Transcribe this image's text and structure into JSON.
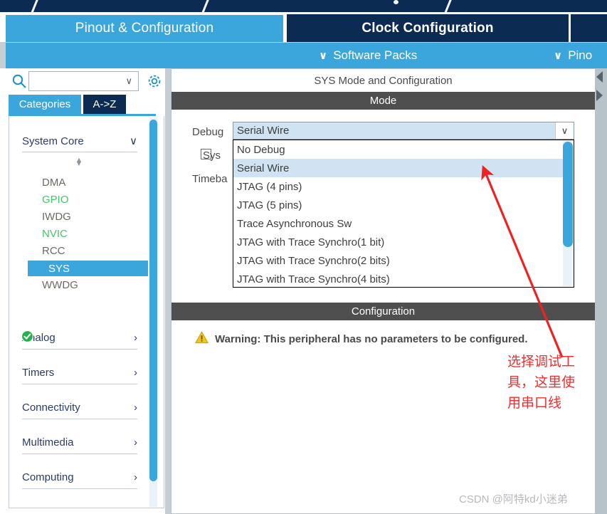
{
  "header": {
    "tabs": [
      {
        "label": "Pinout & Configuration",
        "state": "active"
      },
      {
        "label": "Clock Configuration",
        "state": "inactive"
      },
      {
        "label": "",
        "state": "inactive"
      }
    ],
    "sub_items": [
      {
        "label": "Software Packs",
        "chevron": "chevron-down-icon"
      },
      {
        "label": "Pino",
        "chevron": "chevron-down-icon"
      }
    ]
  },
  "sidebar": {
    "search": {
      "value": "",
      "placeholder": "",
      "icon": "search-icon",
      "caret": "chevron-down-icon"
    },
    "settings_icon": "gear-icon",
    "view_tabs": [
      {
        "label": "Categories",
        "selected": true
      },
      {
        "label": "A->Z",
        "selected": false
      }
    ],
    "groups": [
      {
        "label": "System Core",
        "expanded": true,
        "chevron": "chevron-down-icon"
      },
      {
        "label": "Analog",
        "expanded": false,
        "chevron": "chevron-right-icon"
      },
      {
        "label": "Timers",
        "expanded": false,
        "chevron": "chevron-right-icon"
      },
      {
        "label": "Connectivity",
        "expanded": false,
        "chevron": "chevron-right-icon"
      },
      {
        "label": "Multimedia",
        "expanded": false,
        "chevron": "chevron-right-icon"
      },
      {
        "label": "Computing",
        "expanded": false,
        "chevron": "chevron-right-icon"
      }
    ],
    "peripherals": [
      {
        "label": "DMA",
        "state": "normal"
      },
      {
        "label": "GPIO",
        "state": "configured"
      },
      {
        "label": "IWDG",
        "state": "normal"
      },
      {
        "label": "NVIC",
        "state": "configured"
      },
      {
        "label": "RCC",
        "state": "normal"
      },
      {
        "label": "SYS",
        "state": "selected",
        "icon": "check-circle-icon"
      },
      {
        "label": "WWDG",
        "state": "normal"
      }
    ]
  },
  "main": {
    "title": "SYS Mode and Configuration",
    "mode_header": "Mode",
    "config_header": "Configuration",
    "fields": {
      "debug_label": "Debug",
      "debug_value": "Serial Wire",
      "system_wake_label": "Sys",
      "system_wake_checked": false,
      "timebase_label": "Timeba"
    },
    "dropdown": {
      "open": true,
      "selected": "Serial Wire",
      "options": [
        "No Debug",
        "Serial Wire",
        "JTAG (4 pins)",
        "JTAG (5 pins)",
        "Trace Asynchronous Sw",
        "JTAG with Trace Synchro(1 bit)",
        "JTAG with Trace Synchro(2 bits)",
        "JTAG with Trace Synchro(4 bits)"
      ]
    },
    "warning": {
      "icon": "warning-triangle-icon",
      "text": "Warning: This peripheral has no parameters to be configured."
    }
  },
  "annotation": {
    "arrow": "red-arrow",
    "text": "选择调试工具，这里使用串口线",
    "color": "#ef2f2f"
  },
  "watermark": "CSDN @阿特kd小迷弟",
  "colors": {
    "accent_blue": "#3aa6dc",
    "navy": "#0c2b52",
    "header_gray": "#4f4f4f",
    "highlight": "#cfe3f3",
    "green": "#49c46a"
  }
}
